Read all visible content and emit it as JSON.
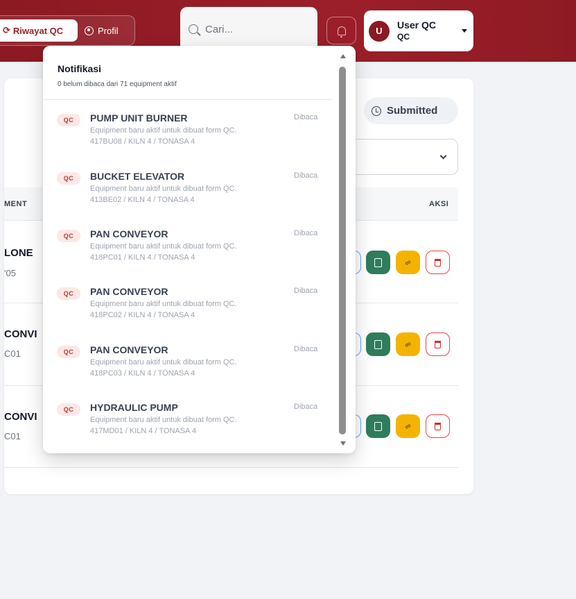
{
  "header": {
    "nav_riwayat": "Riwayat QC",
    "nav_profil": "Profil",
    "search_placeholder": "Cari...",
    "user_initial": "U",
    "user_name": "User QC",
    "user_role": "QC"
  },
  "main": {
    "status_chip": "Submitted",
    "col_equipment_partial": "MENT",
    "col_aksi": "AKSI",
    "rows": [
      {
        "title": "LONE",
        "code": "'05"
      },
      {
        "title": "CONVI",
        "code": "C01"
      },
      {
        "title": "CONVI",
        "code": "C01"
      }
    ]
  },
  "notifications": {
    "title": "Notifikasi",
    "subtitle": "0 belum dibaca dari 71 equipment aktif",
    "items": [
      {
        "badge": "QC",
        "title": "PUMP UNIT BURNER",
        "desc": "Equipment baru aktif untuk dibuat form QC.",
        "meta": "417BU08 / KILN 4 / TONASA 4",
        "status": "Dibaca"
      },
      {
        "badge": "QC",
        "title": "BUCKET ELEVATOR",
        "desc": "Equipment baru aktif untuk dibuat form QC.",
        "meta": "413BE02 / KILN 4 / TONASA 4",
        "status": "Dibaca"
      },
      {
        "badge": "QC",
        "title": "PAN CONVEYOR",
        "desc": "Equipment baru aktif untuk dibuat form QC.",
        "meta": "418PC01 / KILN 4 / TONASA 4",
        "status": "Dibaca"
      },
      {
        "badge": "QC",
        "title": "PAN CONVEYOR",
        "desc": "Equipment baru aktif untuk dibuat form QC.",
        "meta": "418PC02 / KILN 4 / TONASA 4",
        "status": "Dibaca"
      },
      {
        "badge": "QC",
        "title": "PAN CONVEYOR",
        "desc": "Equipment baru aktif untuk dibuat form QC.",
        "meta": "418PC03 / KILN 4 / TONASA 4",
        "status": "Dibaca"
      },
      {
        "badge": "QC",
        "title": "HYDRAULIC PUMP",
        "desc": "Equipment baru aktif untuk dibuat form QC.",
        "meta": "417MD01 / KILN 4 / TONASA 4",
        "status": "Dibaca"
      }
    ]
  },
  "icons": {
    "history": "history-icon",
    "profile": "user-circle-icon",
    "search": "search-icon",
    "bell": "bell-icon",
    "clock": "clock-icon",
    "pdf": "pdf-icon",
    "link": "link-icon",
    "delete": "trash-icon"
  },
  "colors": {
    "brand": "#8c1a22",
    "pdf_button": "#2e7d5b",
    "link_button": "#f5b301",
    "delete_border": "#ef4444",
    "badge_bg": "#fde7e7"
  }
}
